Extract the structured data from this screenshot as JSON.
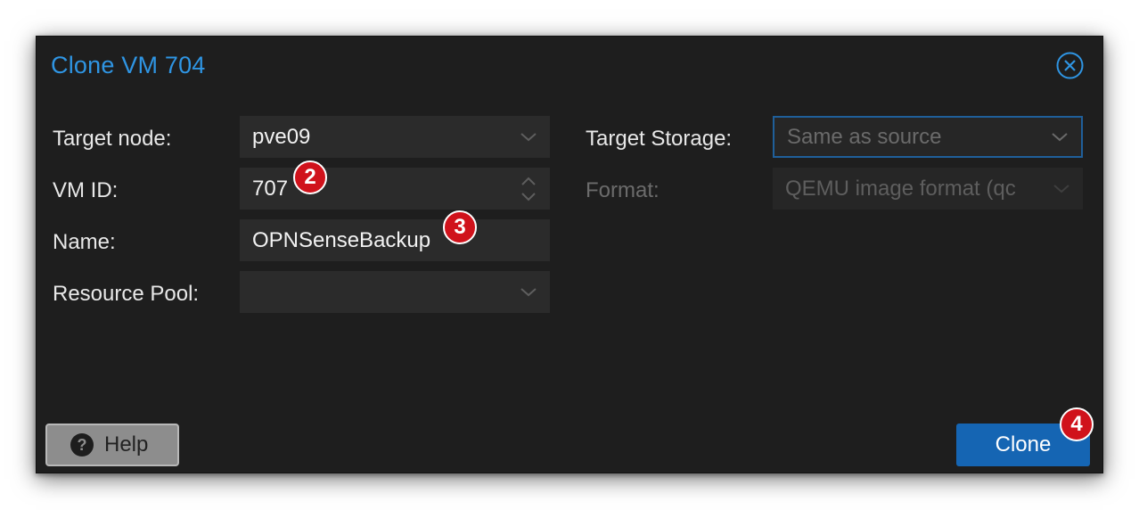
{
  "dialog": {
    "title": "Clone VM 704",
    "close_icon": "circle-x-icon"
  },
  "form": {
    "target_node": {
      "label": "Target node:",
      "value": "pve09"
    },
    "vm_id": {
      "label": "VM ID:",
      "value": "707"
    },
    "name": {
      "label": "Name:",
      "value": "OPNSenseBackup"
    },
    "resource_pool": {
      "label": "Resource Pool:",
      "value": ""
    },
    "target_storage": {
      "label": "Target Storage:",
      "placeholder": "Same as source"
    },
    "format": {
      "label": "Format:",
      "placeholder": "QEMU image format (qc"
    }
  },
  "annotations": [
    "2",
    "3",
    "4"
  ],
  "buttons": {
    "help_label": "Help",
    "clone_label": "Clone"
  },
  "colors": {
    "title": "#2f95e3",
    "clone_button": "#1565b3",
    "badge": "#d0121b",
    "dialog_bg": "#1e1e1e"
  }
}
